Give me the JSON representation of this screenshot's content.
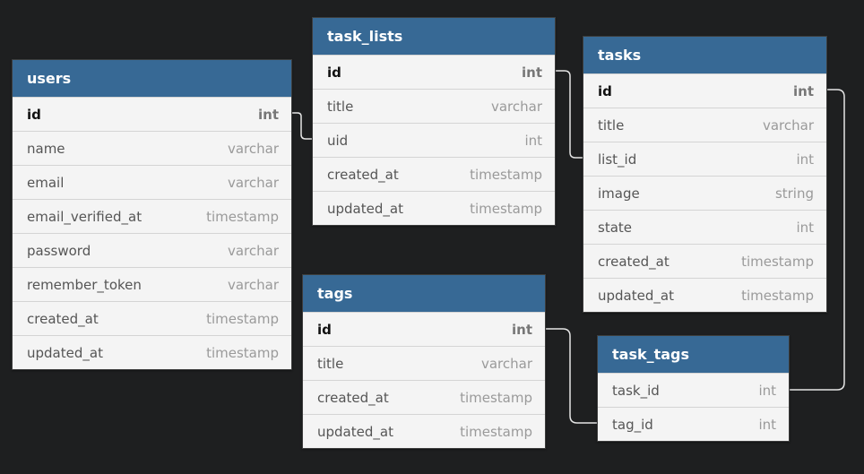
{
  "tables": {
    "users": {
      "name": "users",
      "columns": [
        {
          "name": "id",
          "type": "int",
          "pk": true
        },
        {
          "name": "name",
          "type": "varchar"
        },
        {
          "name": "email",
          "type": "varchar"
        },
        {
          "name": "email_verified_at",
          "type": "timestamp"
        },
        {
          "name": "password",
          "type": "varchar"
        },
        {
          "name": "remember_token",
          "type": "varchar"
        },
        {
          "name": "created_at",
          "type": "timestamp"
        },
        {
          "name": "updated_at",
          "type": "timestamp"
        }
      ]
    },
    "task_lists": {
      "name": "task_lists",
      "columns": [
        {
          "name": "id",
          "type": "int",
          "pk": true
        },
        {
          "name": "title",
          "type": "varchar"
        },
        {
          "name": "uid",
          "type": "int"
        },
        {
          "name": "created_at",
          "type": "timestamp"
        },
        {
          "name": "updated_at",
          "type": "timestamp"
        }
      ]
    },
    "tasks": {
      "name": "tasks",
      "columns": [
        {
          "name": "id",
          "type": "int",
          "pk": true
        },
        {
          "name": "title",
          "type": "varchar"
        },
        {
          "name": "list_id",
          "type": "int"
        },
        {
          "name": "image",
          "type": "string"
        },
        {
          "name": "state",
          "type": "int"
        },
        {
          "name": "created_at",
          "type": "timestamp"
        },
        {
          "name": "updated_at",
          "type": "timestamp"
        }
      ]
    },
    "tags": {
      "name": "tags",
      "columns": [
        {
          "name": "id",
          "type": "int",
          "pk": true
        },
        {
          "name": "title",
          "type": "varchar"
        },
        {
          "name": "created_at",
          "type": "timestamp"
        },
        {
          "name": "updated_at",
          "type": "timestamp"
        }
      ]
    },
    "task_tags": {
      "name": "task_tags",
      "columns": [
        {
          "name": "task_id",
          "type": "int"
        },
        {
          "name": "tag_id",
          "type": "int"
        }
      ]
    }
  },
  "colors": {
    "background": "#1e1f20",
    "header": "#376995",
    "connector": "#e6e6e6"
  }
}
